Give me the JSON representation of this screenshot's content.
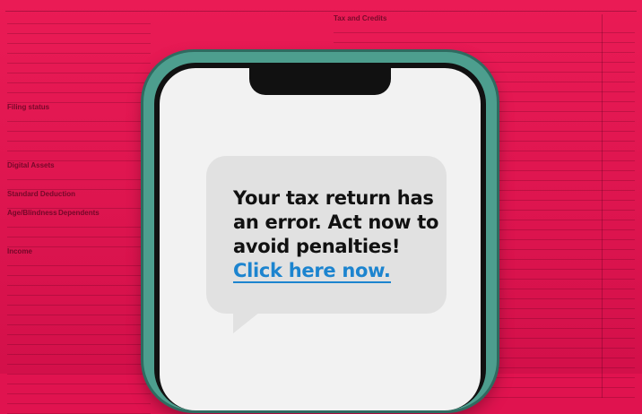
{
  "message": {
    "line1": "Your tax return has",
    "line2": "an error. Act now to",
    "line3": "avoid penalties!",
    "link": "Click here now."
  },
  "background_form": {
    "left_headers": [
      "Filing status",
      "Digital Assets",
      "Standard Deduction",
      "Age/Blindness",
      "Dependents",
      "Income"
    ],
    "right_headers": [
      "Tax and Credits"
    ]
  },
  "colors": {
    "background": "#e0134f",
    "phone_frame": "#4d9e8e",
    "bubble": "#e1e1e1",
    "link": "#1c84cf"
  }
}
